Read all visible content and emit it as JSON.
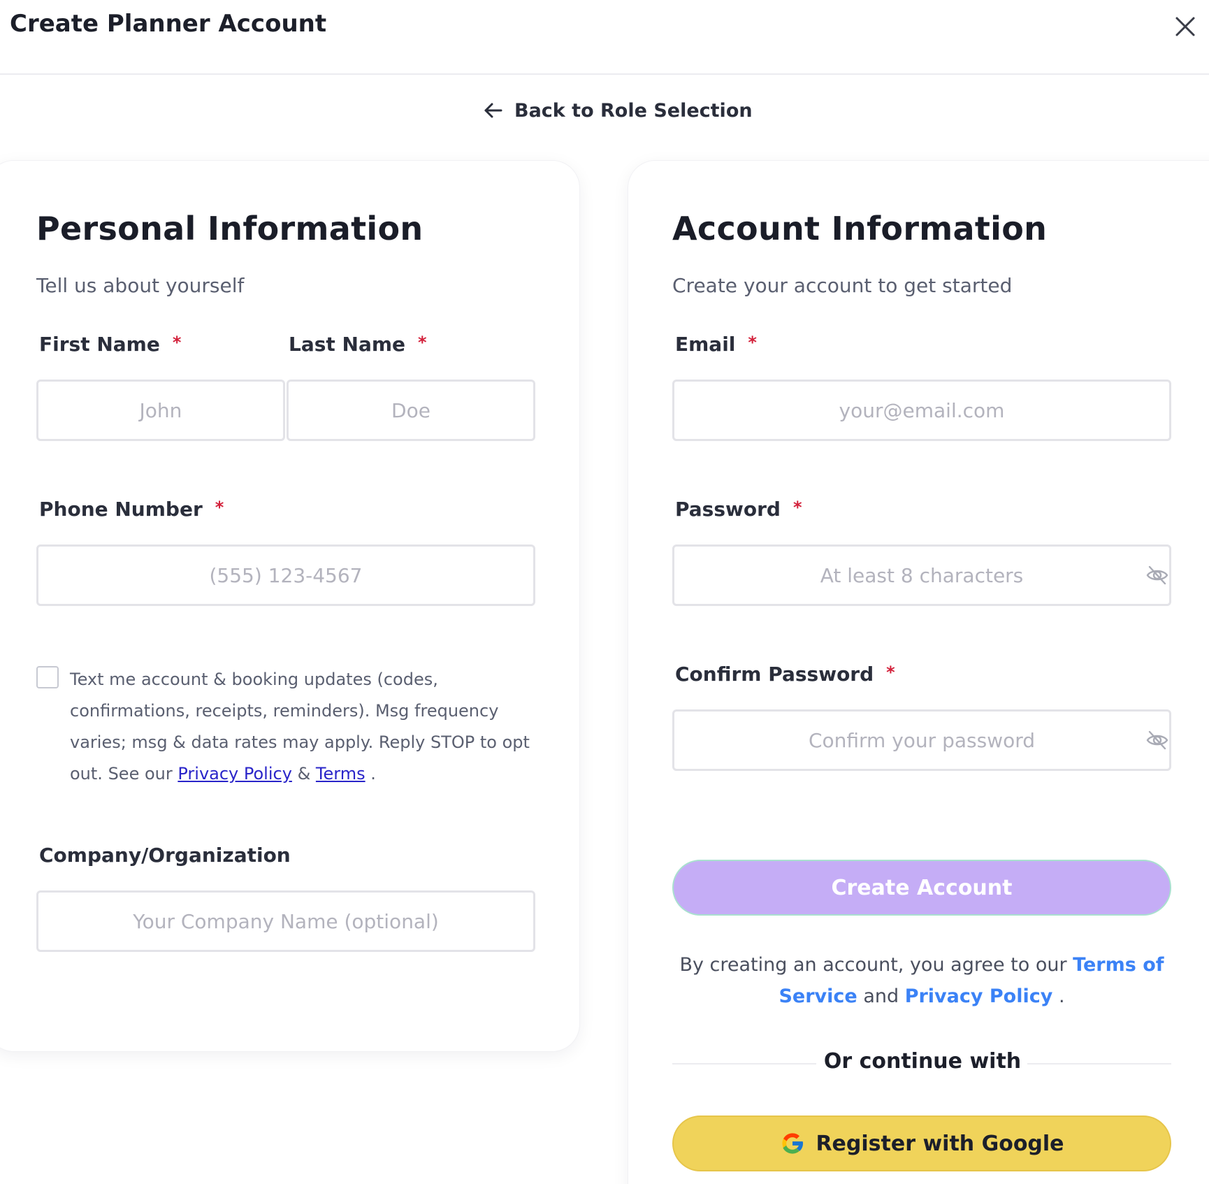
{
  "header": {
    "title": "Create Planner Account",
    "close_icon": "close-icon"
  },
  "back": {
    "label": "Back to Role Selection",
    "icon": "arrow-left-icon"
  },
  "personal": {
    "title": "Personal Information",
    "subtitle": "Tell us about yourself",
    "first_name": {
      "label": "First Name",
      "required": "*",
      "value": "",
      "placeholder": "John"
    },
    "last_name": {
      "label": "Last Name",
      "required": "*",
      "value": "",
      "placeholder": "Doe"
    },
    "phone": {
      "label": "Phone Number",
      "required": "*",
      "value": "",
      "placeholder": "(555) 123-4567"
    },
    "consent": {
      "checked": false,
      "text": "Text me account & booking updates (codes, confirmations, receipts, reminders). Msg frequency varies; msg & data rates may apply. Reply STOP to opt out. See our",
      "privacy_link": "Privacy Policy",
      "amp": "&",
      "terms_link": "Terms",
      "end": "."
    },
    "company": {
      "label": "Company/Organization",
      "value": "",
      "placeholder": "Your Company Name (optional)"
    }
  },
  "account": {
    "title": "Account Information",
    "subtitle": "Create your account to get started",
    "email": {
      "label": "Email",
      "required": "*",
      "value": "",
      "placeholder": "your@email.com"
    },
    "password": {
      "label": "Password",
      "required": "*",
      "value": "",
      "placeholder": "At least 8 characters",
      "icon": "eye-off-icon"
    },
    "confirm": {
      "label": "Confirm Password",
      "required": "*",
      "value": "",
      "placeholder": "Confirm your password",
      "icon": "eye-off-icon"
    },
    "create_label": "Create Account",
    "terms": {
      "prefix": "By creating an account, you agree to our",
      "tos": "Terms of Service",
      "and": "and",
      "privacy": "Privacy Policy",
      "end": "."
    },
    "or_text": "Or continue with",
    "google_label": "Register with Google"
  },
  "colors": {
    "accent_purple": "#c5adf6",
    "google_yellow": "#f0d35a",
    "link_blue": "#3b82f6",
    "link_indigo": "#2a25c9",
    "required_red": "#d3203a"
  }
}
